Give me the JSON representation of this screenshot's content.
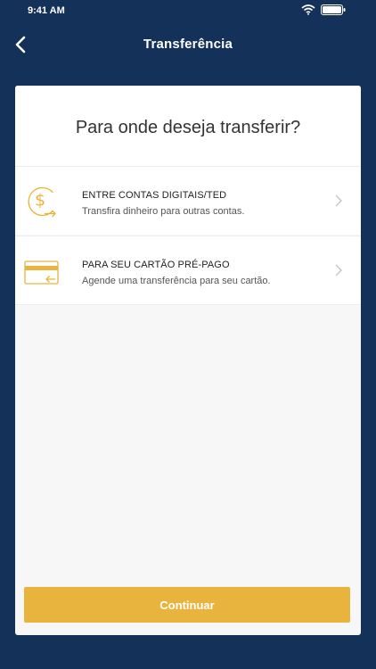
{
  "status_bar": {
    "time": "9:41 AM"
  },
  "nav": {
    "title": "Transferência"
  },
  "card": {
    "question": "Para onde deseja transferir?",
    "options": [
      {
        "title": "ENTRE CONTAS DIGITAIS/TED",
        "subtitle": "Transfira dinheiro para outras contas.",
        "icon": "dollar-transfer-icon"
      },
      {
        "title": "PARA SEU CARTÃO PRÉ-PAGO",
        "subtitle": "Agende uma transferência para seu cartão.",
        "icon": "card-transfer-icon"
      }
    ]
  },
  "footer": {
    "continue_label": "Continuar"
  },
  "colors": {
    "background": "#143159",
    "accent": "#e9b43e",
    "card": "#f7f7f7"
  }
}
